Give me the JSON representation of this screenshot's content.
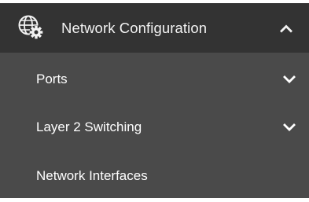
{
  "colors": {
    "header_bg": "#333333",
    "submenu_bg": "#4a4a4a",
    "text": "#ffffff"
  },
  "section": {
    "title": "Network Configuration",
    "icon": "network-settings-icon",
    "expanded": true,
    "toggle_icon": "chevron-up-icon"
  },
  "submenu": {
    "items": [
      {
        "label": "Ports",
        "expandable": true,
        "icon": "chevron-down-icon"
      },
      {
        "label": "Layer 2 Switching",
        "expandable": true,
        "icon": "chevron-down-icon"
      },
      {
        "label": "Network Interfaces",
        "expandable": false
      }
    ]
  }
}
